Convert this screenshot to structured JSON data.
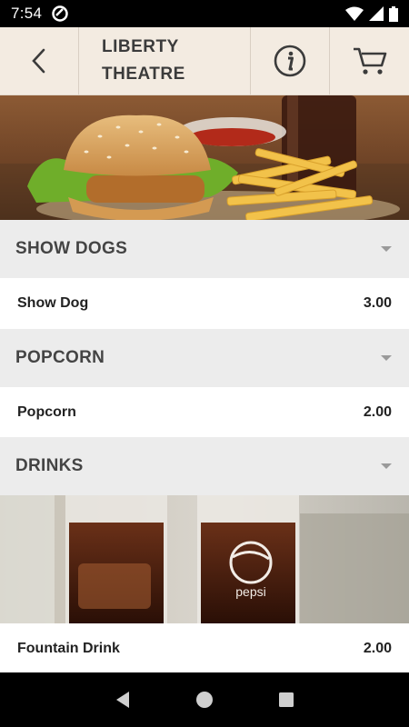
{
  "status_bar": {
    "time": "7:54"
  },
  "header": {
    "title": "LIBERTY\nTHEATRE"
  },
  "sections": [
    {
      "title": "SHOW DOGS",
      "items": [
        {
          "name": "Show Dog",
          "price": "3.00"
        }
      ]
    },
    {
      "title": "POPCORN",
      "items": [
        {
          "name": "Popcorn",
          "price": "2.00"
        }
      ]
    },
    {
      "title": "DRINKS",
      "items": [
        {
          "name": "Fountain Drink",
          "price": "2.00"
        }
      ],
      "image_brand": "pepsi"
    }
  ],
  "icons": {
    "back": "chevron-left-icon",
    "info": "info-icon",
    "cart": "cart-icon"
  }
}
